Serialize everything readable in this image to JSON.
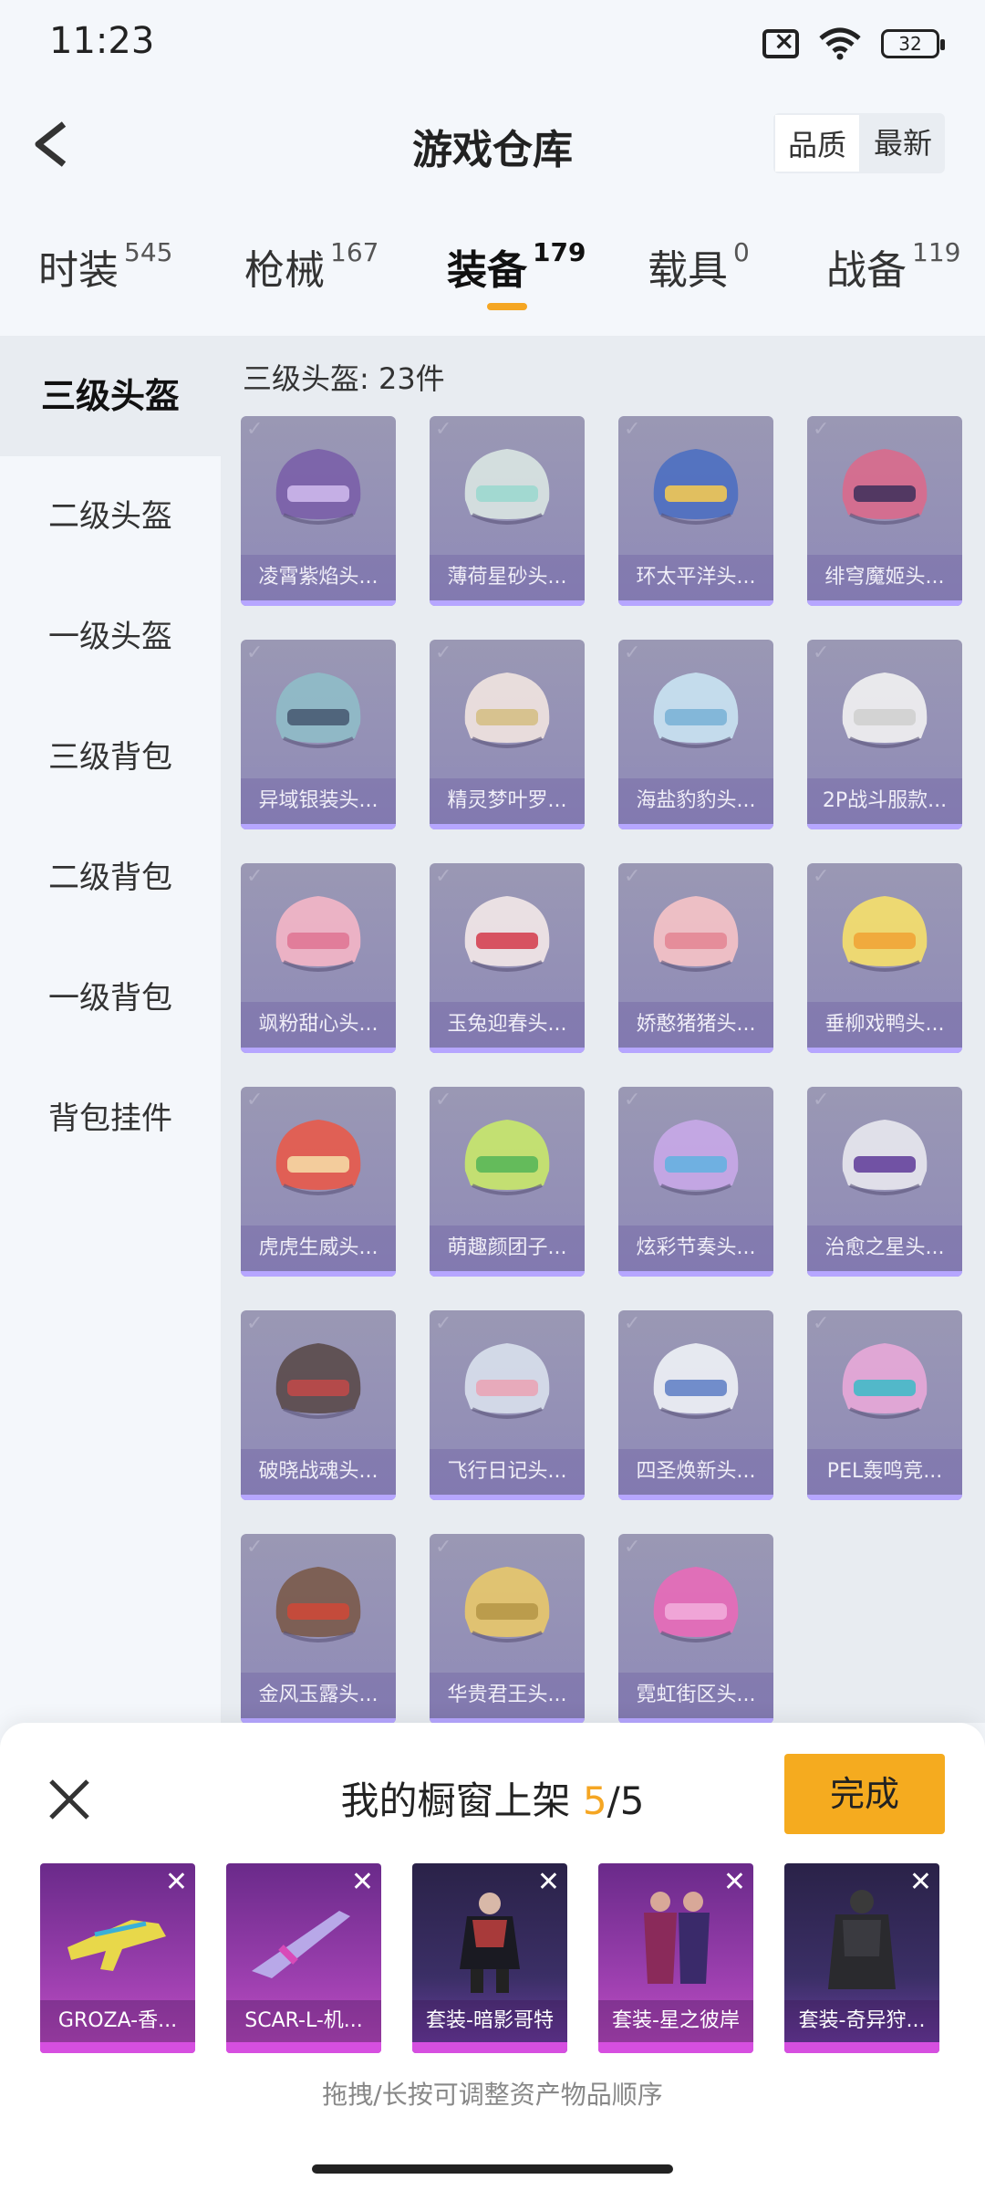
{
  "status": {
    "time": "11:23",
    "battery": "32"
  },
  "header": {
    "title": "游戏仓库",
    "sort_options": [
      "品质",
      "最新"
    ]
  },
  "tabs": [
    {
      "label": "时装",
      "count": "545"
    },
    {
      "label": "枪械",
      "count": "167"
    },
    {
      "label": "装备",
      "count": "179"
    },
    {
      "label": "载具",
      "count": "0"
    },
    {
      "label": "战备",
      "count": "119"
    }
  ],
  "sidebar": {
    "items": [
      "三级头盔",
      "二级头盔",
      "一级头盔",
      "三级背包",
      "二级背包",
      "一级背包",
      "背包挂件"
    ]
  },
  "content": {
    "section_title": "三级头盔: 23件",
    "items": [
      "凌霄紫焰头...",
      "薄荷星砂头...",
      "环太平洋头...",
      "绯穹魔姬头...",
      "异域银装头...",
      "精灵梦叶罗...",
      "海盐豹豹头...",
      "2P战斗服款...",
      "飒粉甜心头...",
      "玉兔迎春头...",
      "娇憨猪猪头...",
      "垂柳戏鸭头...",
      "虎虎生威头...",
      "萌趣颜团子...",
      "炫彩节奏头...",
      "治愈之星头...",
      "破晓战魂头...",
      "飞行日记头...",
      "四圣焕新头...",
      "PEL轰鸣竞...",
      "金风玉露头...",
      "华贵君王头...",
      "霓虹街区头..."
    ]
  },
  "sheet": {
    "title_prefix": "我的橱窗上架 ",
    "current": "5",
    "separator": "/",
    "total": "5",
    "done": "完成",
    "shelf": [
      "GROZA-香...",
      "SCAR-L-机...",
      "套装-暗影哥特",
      "套装-星之彼岸",
      "套装-奇异狩..."
    ],
    "hint": "拖拽/长按可调整资产物品顺序"
  }
}
